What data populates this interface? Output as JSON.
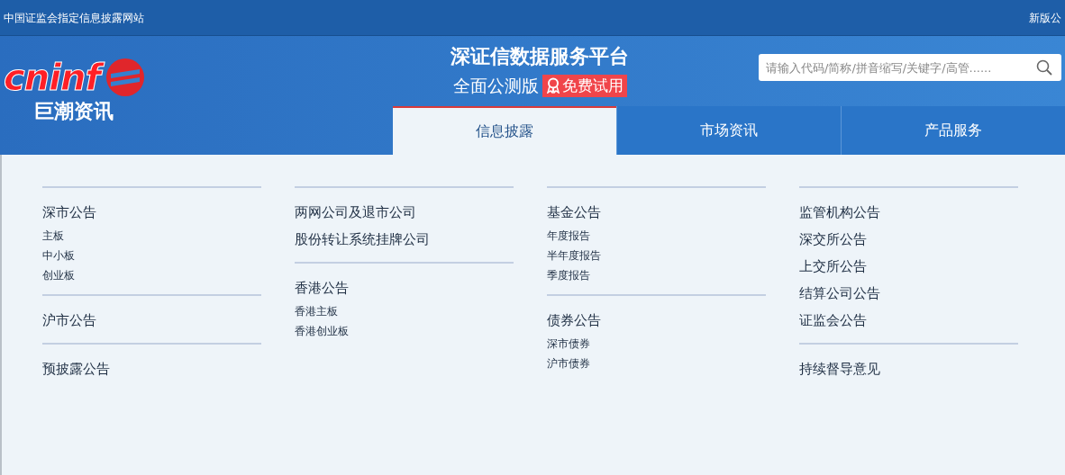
{
  "top_bar": {
    "left_text": "中国证监会指定信息披露网站",
    "right_text": "新版公"
  },
  "logo": {
    "latin": "cninf",
    "chinese": "巨潮资讯"
  },
  "header": {
    "title": "深证信数据服务平台",
    "subtitle": "全面公测版",
    "badge": "免费试用"
  },
  "search": {
    "placeholder": "请输入代码/简称/拼音缩写/关键字/高管......"
  },
  "nav_tabs": [
    {
      "label": "信息披露",
      "selected": true
    },
    {
      "label": "市场资讯",
      "selected": false
    },
    {
      "label": "产品服务",
      "selected": false
    }
  ],
  "menu_columns": [
    {
      "groups": [
        {
          "titles": [
            "深市公告"
          ],
          "items": [
            "主板",
            "中小板",
            "创业板"
          ]
        },
        {
          "titles": [
            "沪市公告"
          ]
        },
        {
          "titles": [
            "预披露公告"
          ]
        }
      ]
    },
    {
      "groups": [
        {
          "titles": [
            "两网公司及退市公司",
            "股份转让系统挂牌公司"
          ]
        },
        {
          "titles": [
            "香港公告"
          ],
          "items": [
            "香港主板",
            "香港创业板"
          ]
        }
      ]
    },
    {
      "groups": [
        {
          "titles": [
            "基金公告"
          ],
          "items": [
            "年度报告",
            "半年度报告",
            "季度报告"
          ]
        },
        {
          "titles": [
            "债券公告"
          ],
          "items": [
            "深市债券",
            "沪市债券"
          ]
        }
      ]
    },
    {
      "groups": [
        {
          "titles": [
            "监管机构公告",
            "深交所公告",
            "上交所公告",
            "结算公司公告",
            "证监会公告"
          ]
        },
        {
          "titles": [
            "持续督导意见"
          ]
        }
      ]
    }
  ]
}
